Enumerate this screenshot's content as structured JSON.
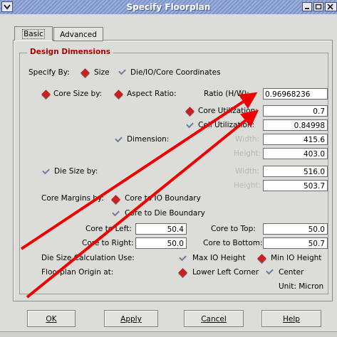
{
  "window": {
    "title": "Specify Floorplan"
  },
  "tabs": [
    {
      "label": "Basic"
    },
    {
      "label": "Advanced"
    }
  ],
  "group": {
    "title": "Design Dimensions"
  },
  "specify_by": {
    "label": "Specify By:",
    "options": [
      {
        "label": "Size",
        "selected": true
      },
      {
        "label": "Die/IO/Core Coordinates",
        "selected": false
      }
    ]
  },
  "core_size": {
    "label": "Core Size by:",
    "aspect_ratio_label": "Aspect Ratio:",
    "ratio_label": "Ratio (H/W):",
    "ratio_value": "0.96968236",
    "core_util_label": "Core Utilization:",
    "core_util_value": "0.7",
    "cell_util_label": "Cell Utilization:",
    "cell_util_value": "0.84998",
    "dimension_label": "Dimension:",
    "width_label": "Width:",
    "width_value": "415.6",
    "height_label": "Height:",
    "height_value": "403.0"
  },
  "die_size": {
    "label": "Die Size by:",
    "width_label": "Width:",
    "width_value": "516.0",
    "height_label": "Height:",
    "height_value": "503.7"
  },
  "core_margins": {
    "label": "Core Margins by:",
    "opt_io": "Core to IO Boundary",
    "opt_die": "Core to Die Boundary",
    "left_label": "Core to Left:",
    "left_value": "50.4",
    "top_label": "Core to Top:",
    "top_value": "50.0",
    "right_label": "Core to Right:",
    "right_value": "50.0",
    "bottom_label": "Core to Bottom:",
    "bottom_value": "50.7"
  },
  "die_calc": {
    "label": "Die Size Calculation Use:",
    "opt_max": "Max IO Height",
    "opt_min": "Min IO Height"
  },
  "origin": {
    "label": "Floorplan Origin at:",
    "opt_lower_left": "Lower Left Corner",
    "opt_center": "Center"
  },
  "unit": "Unit: Micron",
  "buttons": {
    "ok": "OK",
    "apply": "Apply",
    "cancel": "Cancel",
    "help": "Help"
  },
  "colors": {
    "arrow": "#ee0000",
    "selected_radio": "#c62020",
    "group_title": "#b00000"
  }
}
